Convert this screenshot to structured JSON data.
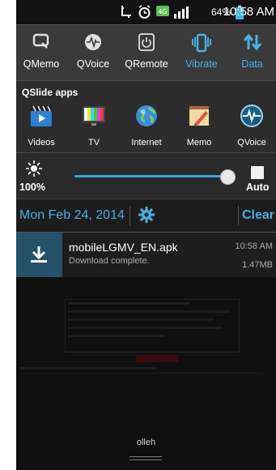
{
  "status_bar": {
    "network_badge": "4G",
    "battery_percent": "64%",
    "time": "10:58 AM"
  },
  "quick_settings": [
    {
      "label": "QMemo",
      "icon": "qmemo-icon",
      "active": false
    },
    {
      "label": "QVoice",
      "icon": "qvoice-icon",
      "active": false
    },
    {
      "label": "QRemote",
      "icon": "qremote-icon",
      "active": false
    },
    {
      "label": "Vibrate",
      "icon": "vibrate-icon",
      "active": true
    },
    {
      "label": "Data",
      "icon": "data-icon",
      "active": true
    }
  ],
  "qslide": {
    "title": "QSlide apps",
    "apps": [
      {
        "label": "Videos",
        "icon": "videos-icon"
      },
      {
        "label": "TV",
        "icon": "tv-icon"
      },
      {
        "label": "Internet",
        "icon": "internet-icon"
      },
      {
        "label": "Memo",
        "icon": "memo-icon"
      },
      {
        "label": "QVoice",
        "icon": "qvoice-app-icon"
      }
    ]
  },
  "brightness": {
    "percent_label": "100%",
    "level": 1.0,
    "auto_label": "Auto"
  },
  "date_bar": {
    "date": "Mon Feb 24, 2014",
    "clear_label": "Clear"
  },
  "notification": {
    "title": "mobileLGMV_EN.apk",
    "subtitle": "Download complete.",
    "time": "10:58 AM",
    "size": "1.47MB"
  },
  "carrier": "olleh",
  "colors": {
    "accent": "#4aaee0",
    "status_active": "#49b3e6",
    "notification_icon_bg": "#25516b"
  }
}
